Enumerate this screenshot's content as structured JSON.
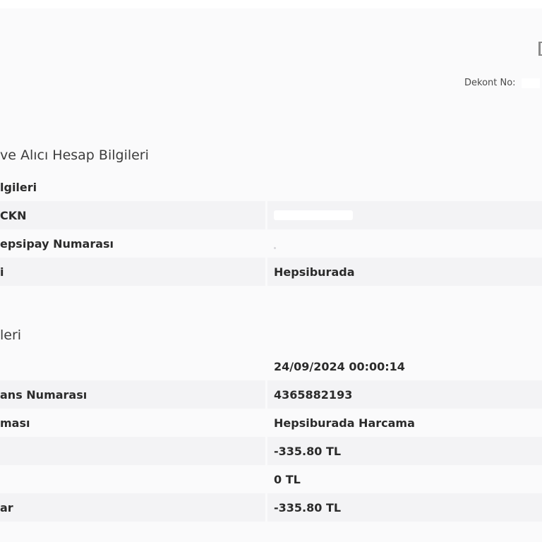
{
  "header": {
    "receipt_label": "Dekont No:",
    "receipt_value": ""
  },
  "sections": [
    {
      "title": "ve Alıcı Hesap Bilgileri",
      "rows": [
        {
          "label": "lgileri",
          "value": ""
        },
        {
          "label": "CKN",
          "value": ""
        },
        {
          "label": "epsipay Numarası",
          "value": ""
        },
        {
          "label": "i",
          "value": "Hepsiburada"
        }
      ]
    },
    {
      "title": "leri",
      "rows": [
        {
          "label": "",
          "value": "24/09/2024 00:00:14"
        },
        {
          "label": "ans Numarası",
          "value": "4365882193"
        },
        {
          "label": "ması",
          "value": "Hepsiburada Harcama"
        },
        {
          "label": "",
          "value": "-335.80 TL"
        },
        {
          "label": "",
          "value": "0 TL"
        },
        {
          "label": "ar",
          "value": "-335.80 TL"
        }
      ]
    }
  ]
}
